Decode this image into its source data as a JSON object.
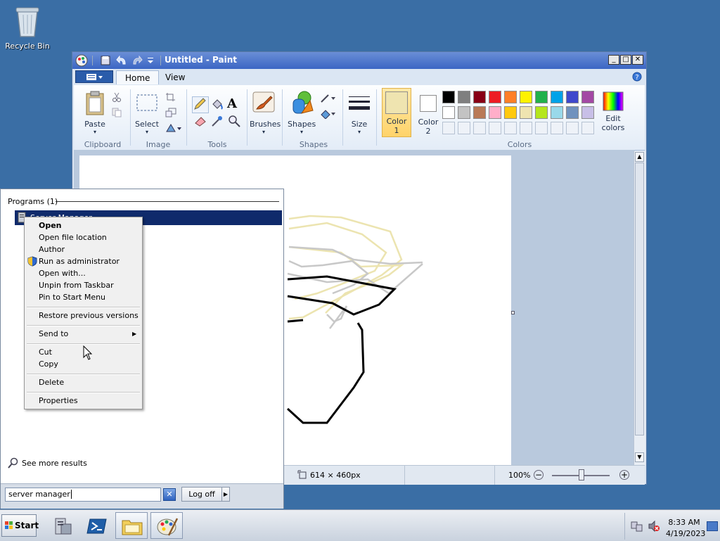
{
  "desktop": {
    "recycle_bin": "Recycle Bin"
  },
  "paint": {
    "title": "Untitled - Paint",
    "tabs": [
      "Home",
      "View"
    ],
    "groups": {
      "clipboard": {
        "label": "Clipboard",
        "paste": "Paste"
      },
      "image": {
        "label": "Image",
        "select": "Select"
      },
      "tools": {
        "label": "Tools"
      },
      "shapes": {
        "label": "Shapes",
        "brushes": "Brushes",
        "shapes": "Shapes"
      },
      "size": "Size",
      "color1_line1": "Color",
      "color1_line2": "1",
      "color2_line1": "Color",
      "color2_line2": "2",
      "colors": {
        "label": "Colors"
      },
      "edit_colors_line1": "Edit",
      "edit_colors_line2": "colors"
    },
    "palette_row1": [
      "#000000",
      "#7f7f7f",
      "#880015",
      "#ed1c24",
      "#ff7f27",
      "#fff200",
      "#22b14c",
      "#00a2e8",
      "#3f48cc",
      "#a349a4"
    ],
    "palette_row2": [
      "#ffffff",
      "#c3c3c3",
      "#b97a57",
      "#ffaec9",
      "#ffc90e",
      "#efe4b0",
      "#b5e61d",
      "#99d9ea",
      "#7092be",
      "#c8bfe7"
    ],
    "color1_value": "#efe4b0",
    "status": {
      "size": "614 × 460px",
      "zoom": "100%"
    }
  },
  "start_menu": {
    "section_header": "Programs (1)",
    "result": "Server Manager",
    "see_more": "See more results",
    "search_value": "server manager",
    "log_off": "Log off"
  },
  "context_menu": {
    "items": [
      "Open",
      "Open file location",
      "Author",
      "Run as administrator",
      "Open with...",
      "Unpin from Taskbar",
      "Pin to Start Menu",
      "Restore previous versions",
      "Send to",
      "Cut",
      "Copy",
      "Delete",
      "Properties"
    ]
  },
  "taskbar": {
    "start": "Start",
    "time": "8:33 AM",
    "date": "4/19/2023"
  }
}
